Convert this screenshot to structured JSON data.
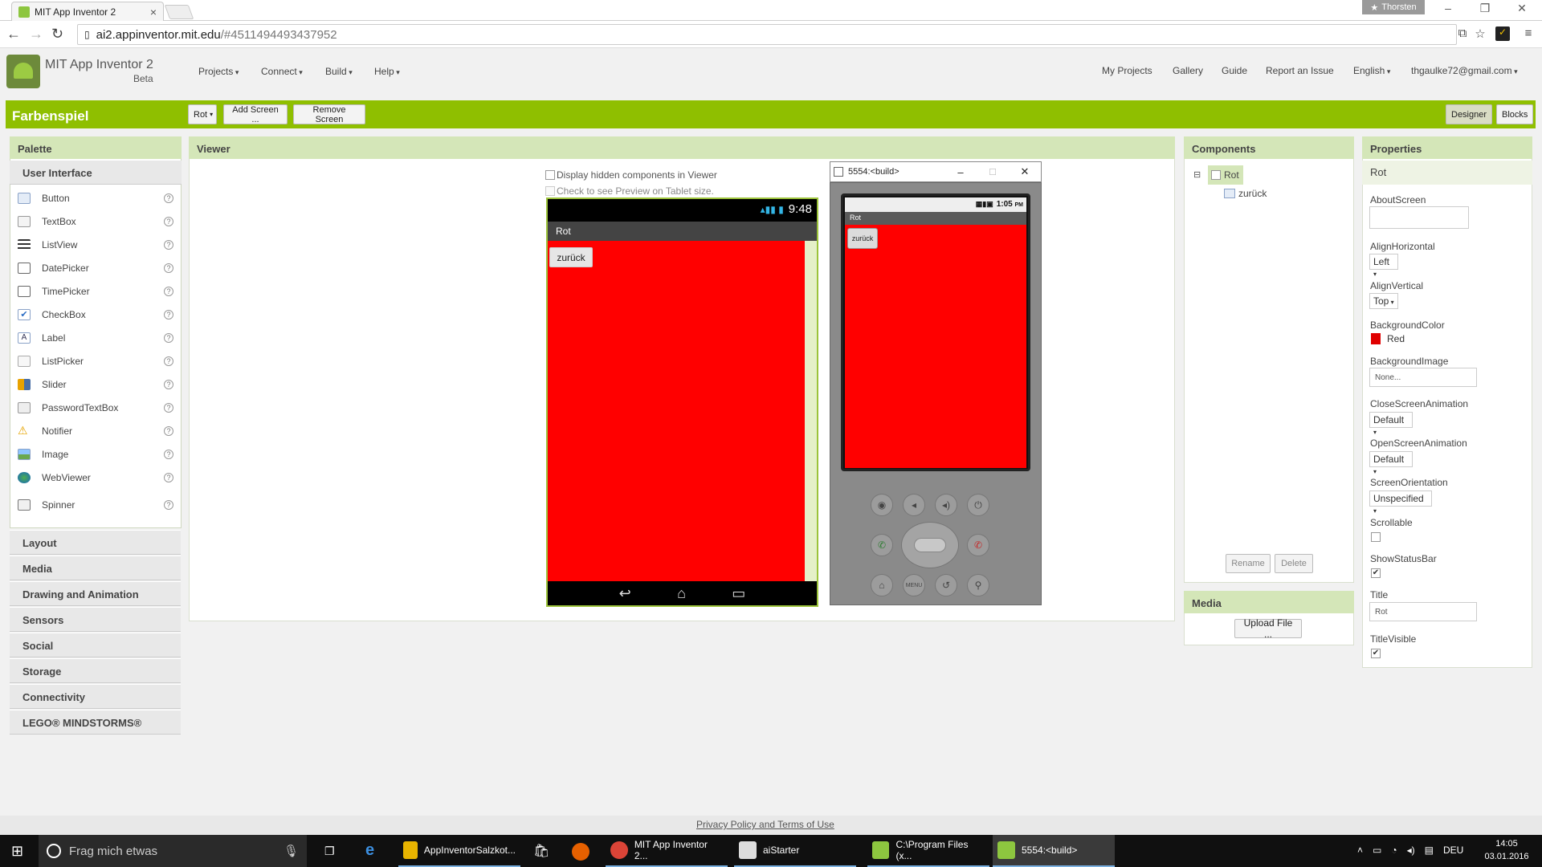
{
  "browser": {
    "tab_title": "MIT App Inventor 2",
    "profile_name": "Thorsten",
    "url_host": "ai2.appinventor.mit.edu",
    "url_path": "/#4511494493437952"
  },
  "header": {
    "brand": "MIT App Inventor 2",
    "beta": "Beta",
    "menus": [
      "Projects",
      "Connect",
      "Build",
      "Help"
    ],
    "right_links": [
      "My Projects",
      "Gallery",
      "Guide",
      "Report an Issue"
    ],
    "language": "English",
    "account": "thgaulke72@gmail.com"
  },
  "toolbar": {
    "project_name": "Farbenspiel",
    "screen_select": "Rot",
    "add_screen": "Add Screen ...",
    "remove_screen": "Remove Screen",
    "designer": "Designer",
    "blocks": "Blocks"
  },
  "palette": {
    "title": "Palette",
    "section": "User Interface",
    "items": [
      "Button",
      "TextBox",
      "ListView",
      "DatePicker",
      "TimePicker",
      "CheckBox",
      "Label",
      "ListPicker",
      "Slider",
      "PasswordTextBox",
      "Notifier",
      "Image",
      "WebViewer",
      "Spinner"
    ],
    "help_glyph": "?",
    "drawers": [
      "Layout",
      "Media",
      "Drawing and Animation",
      "Sensors",
      "Social",
      "Storage",
      "Connectivity",
      "LEGO® MINDSTORMS®"
    ]
  },
  "viewer": {
    "title": "Viewer",
    "display_hidden": "Display hidden components in Viewer",
    "tablet_preview": "Check to see Preview on Tablet size.",
    "status_time": "9:48",
    "screen_title": "Rot",
    "button_text": "zurück",
    "screen_color": "#ff0000"
  },
  "emulator": {
    "window_title": "5554:<build>",
    "status_time": "1:05",
    "status_ampm": "PM",
    "screen_title": "Rot",
    "button_text": "zurück",
    "menu_label": "MENU"
  },
  "components": {
    "title": "Components",
    "root": "Rot",
    "child": "zurück",
    "rename": "Rename",
    "delete": "Delete",
    "collapse_glyph": "⊟"
  },
  "media": {
    "title": "Media",
    "upload": "Upload File ..."
  },
  "properties": {
    "title": "Properties",
    "component": "Rot",
    "about_screen": "AboutScreen",
    "align_horizontal": "AlignHorizontal",
    "align_horizontal_val": "Left",
    "align_vertical": "AlignVertical",
    "align_vertical_val": "Top",
    "background_color": "BackgroundColor",
    "background_color_val": "Red",
    "background_color_hex": "#e00000",
    "background_image": "BackgroundImage",
    "background_image_val": "None...",
    "close_anim": "CloseScreenAnimation",
    "close_anim_val": "Default",
    "open_anim": "OpenScreenAnimation",
    "open_anim_val": "Default",
    "orientation": "ScreenOrientation",
    "orientation_val": "Unspecified",
    "scrollable": "Scrollable",
    "scrollable_checked": false,
    "show_status": "ShowStatusBar",
    "show_status_checked": true,
    "title_label": "Title",
    "title_val": "Rot",
    "title_visible": "TitleVisible",
    "title_visible_checked": true,
    "check_glyph": "✔"
  },
  "footer": {
    "privacy": "Privacy Policy and Terms of Use"
  },
  "taskbar": {
    "search": "Frag mich etwas",
    "apps": [
      "AppInventorSalzkot...",
      "MIT App Inventor 2...",
      "aiStarter",
      "C:\\Program Files (x...",
      "5554:<build>"
    ],
    "lang": "DEU",
    "time": "14:05",
    "date": "03.01.2016"
  }
}
